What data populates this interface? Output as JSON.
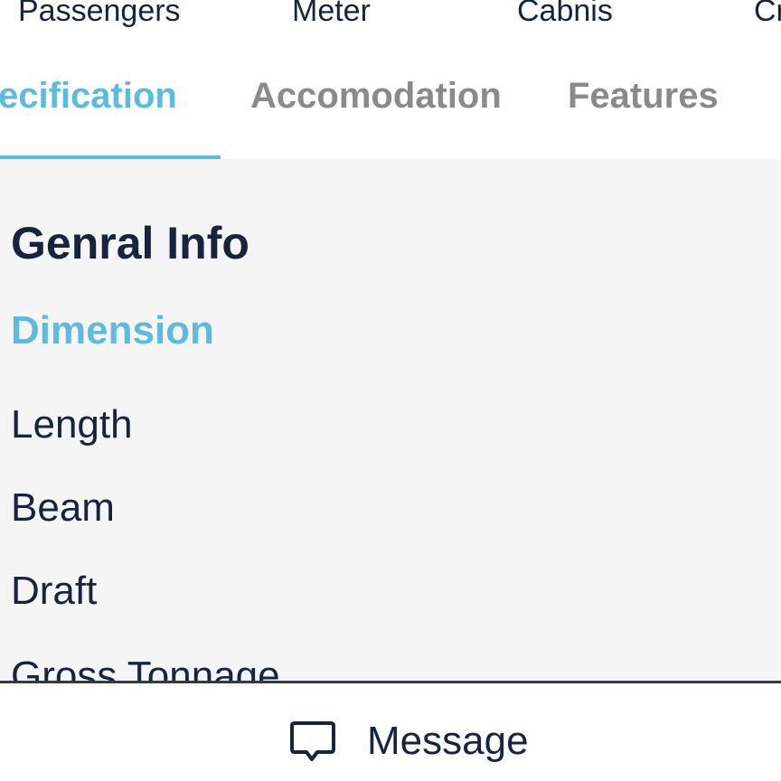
{
  "stats_row": {
    "items": [
      "Passengers",
      "Meter",
      "Cabnis",
      "Cr"
    ]
  },
  "tabs": {
    "items": [
      {
        "label": "ecification",
        "active": true
      },
      {
        "label": "Accomodation",
        "active": false
      },
      {
        "label": "Features",
        "active": false
      }
    ]
  },
  "content": {
    "section_title": "Genral Info",
    "subsection_title": "Dimension",
    "rows": [
      "Length",
      "Beam",
      "Draft",
      "Gross Tonnage"
    ]
  },
  "footer": {
    "message_label": "Message",
    "icon": "chat-bubble-icon"
  },
  "colors": {
    "accent": "#5bbbe0",
    "text_dark": "#16243d",
    "tab_inactive": "#8a8a8a",
    "content_bg": "#f5f5f6"
  }
}
